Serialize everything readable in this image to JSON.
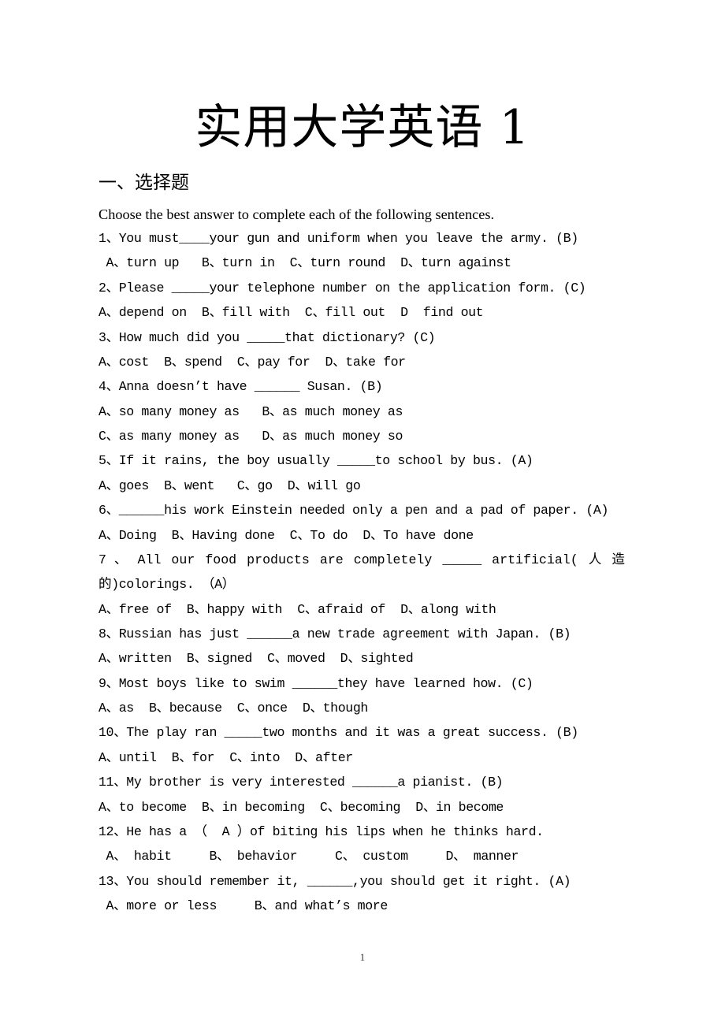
{
  "document": {
    "title": "实用大学英语 1",
    "section_heading": "一、选择题",
    "instructions": "Choose the best answer to complete each of the following sentences.",
    "questions": [
      {
        "number": 1,
        "stem": "1、You must____your gun and uniform when you leave the army. (B)",
        "options_lines": [
          " A、turn up   B、turn in  C、turn round  D、turn against"
        ],
        "answer": "B"
      },
      {
        "number": 2,
        "stem": "2、Please _____your telephone number on the application form. (C)",
        "options_lines": [
          "A、depend on  B、fill with  C、fill out  D  find out"
        ],
        "answer": "C"
      },
      {
        "number": 3,
        "stem": "3、How much did you _____that dictionary? (C)",
        "options_lines": [
          "A、cost  B、spend  C、pay for  D、take for"
        ],
        "answer": "C"
      },
      {
        "number": 4,
        "stem": "4、Anna doesn’t have ______ Susan. (B)",
        "options_lines": [
          "A、so many money as   B、as much money as",
          "C、as many money as   D、as much money so"
        ],
        "answer": "B"
      },
      {
        "number": 5,
        "stem": "5、If it rains, the boy usually _____to school by bus. (A)",
        "options_lines": [
          "A、goes  B、went   C、go  D、will go"
        ],
        "answer": "A"
      },
      {
        "number": 6,
        "stem": "6、______his work Einstein needed only a pen and a pad of paper. (A)",
        "options_lines": [
          "A、Doing  B、Having done  C、To do  D、To have done"
        ],
        "answer": "A"
      },
      {
        "number": 7,
        "stem_words": [
          "7 、",
          "All",
          "our",
          "food",
          "products",
          "are",
          "completely",
          "_____",
          "artificial(",
          "人",
          "造"
        ],
        "stem_continuation": "的)colorings. （A）",
        "options_lines": [
          "A、free of  B、happy with  C、afraid of  D、along with"
        ],
        "answer": "A"
      },
      {
        "number": 8,
        "stem": "8、Russian has just ______a new trade agreement with Japan. (B)",
        "options_lines": [
          "A、written  B、signed  C、moved  D、sighted"
        ],
        "answer": "B"
      },
      {
        "number": 9,
        "stem": "9、Most boys like to swim ______they have learned how. (C)",
        "options_lines": [
          "A、as  B、because  C、once  D、though"
        ],
        "answer": "C"
      },
      {
        "number": 10,
        "stem": "10、The play ran _____two months and it was a great success. (B)",
        "options_lines": [
          "A、until  B、for  C、into  D、after"
        ],
        "answer": "B"
      },
      {
        "number": 11,
        "stem": "11、My brother is very interested ______a pianist. (B)",
        "options_lines": [
          "A、to become  B、in becoming  C、becoming  D、in become"
        ],
        "answer": "B"
      },
      {
        "number": 12,
        "stem": "12、He has a （  A ）of biting his lips when he thinks hard.",
        "options_lines": [
          " A、 habit     B、 behavior     C、 custom     D、 manner"
        ],
        "answer": "A"
      },
      {
        "number": 13,
        "stem": "13、You should remember it, ______,you should get it right. (A)",
        "options_lines": [
          " A、more or less     B、and what’s more"
        ],
        "answer": "A"
      }
    ],
    "page_number": "1"
  }
}
